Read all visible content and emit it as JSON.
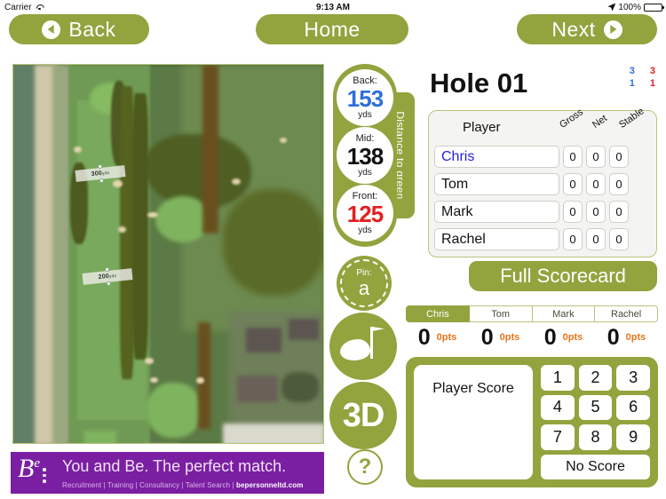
{
  "statusbar": {
    "carrier": "Carrier",
    "time": "9:13 AM",
    "battery": "100%"
  },
  "topnav": {
    "back": "Back",
    "home": "Home",
    "next": "Next"
  },
  "map": {
    "markers": [
      {
        "text": "300",
        "unit": "yds"
      },
      {
        "text": "200",
        "unit": "yds"
      }
    ]
  },
  "distance": {
    "tab_label": "Distance to green",
    "back": {
      "label": "Back:",
      "value": "153",
      "unit": "yds",
      "color": "#2e6fd8"
    },
    "mid": {
      "label": "Mid:",
      "value": "138",
      "unit": "yds",
      "color": "#111111"
    },
    "front": {
      "label": "Front:",
      "value": "125",
      "unit": "yds",
      "color": "#e12020"
    }
  },
  "pin": {
    "label": "Pin:",
    "value": "a"
  },
  "view_buttons": {
    "green": "green-view-icon",
    "three_d": "3D",
    "help": "?"
  },
  "hole": {
    "title": "Hole 01",
    "par": "3",
    "si": "1",
    "par_alt": "3",
    "si_alt": "1"
  },
  "scorecard": {
    "header": {
      "player": "Player",
      "gross": "Gross",
      "net": "Net",
      "stable": "Stable"
    },
    "rows": [
      {
        "name": "Chris",
        "gross": "0",
        "net": "0",
        "stable": "0",
        "active": true
      },
      {
        "name": "Tom",
        "gross": "0",
        "net": "0",
        "stable": "0",
        "active": false
      },
      {
        "name": "Mark",
        "gross": "0",
        "net": "0",
        "stable": "0",
        "active": false
      },
      {
        "name": "Rachel",
        "gross": "0",
        "net": "0",
        "stable": "0",
        "active": false
      }
    ],
    "full_scorecard": "Full Scorecard"
  },
  "player_tabs": [
    {
      "label": "Chris",
      "selected": true,
      "total": "0",
      "points": "0pts"
    },
    {
      "label": "Tom",
      "selected": false,
      "total": "0",
      "points": "0pts"
    },
    {
      "label": "Mark",
      "selected": false,
      "total": "0",
      "points": "0pts"
    },
    {
      "label": "Rachel",
      "selected": false,
      "total": "0",
      "points": "0pts"
    }
  ],
  "keypad": {
    "score_label": "Player Score",
    "keys": [
      "1",
      "2",
      "3",
      "4",
      "5",
      "6",
      "7",
      "8",
      "9"
    ],
    "no_score": "No Score"
  },
  "ad": {
    "logo": "B",
    "logo_sup": "e",
    "headline": "You and Be. The perfect match.",
    "subline_plain": "Recruitment | Training | Consultancy | Talent Search | ",
    "subline_bold": "bepersonneltd.com"
  },
  "colors": {
    "green": "#93a33e",
    "accent_orange": "#e8751a",
    "ad_purple": "#7b1fa2"
  }
}
